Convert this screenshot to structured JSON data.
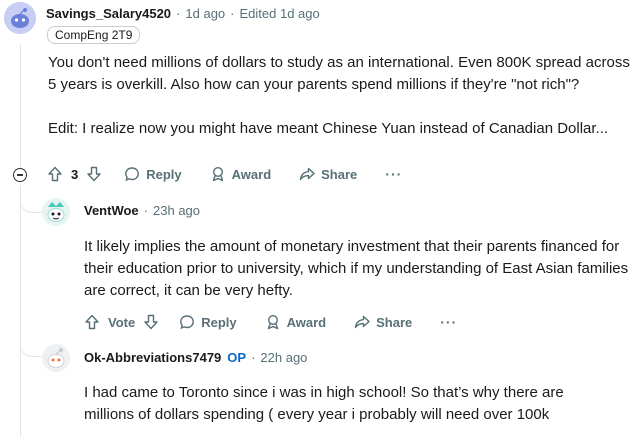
{
  "comments": [
    {
      "author": "Savings_Salary4520",
      "time": "1d ago",
      "edited": "Edited 1d ago",
      "flair": "CompEng 2T9",
      "paragraphs": [
        "You don't need millions of dollars to study as an international. Even 800K spread across 5 years is overkill. Also how can your parents spend millions if they're \"not rich\"?",
        "Edit: I realize now you might have meant Chinese Yuan instead of Canadian Dollar..."
      ],
      "vote_count": "3",
      "actions": {
        "reply": "Reply",
        "award": "Award",
        "share": "Share",
        "more": "···"
      }
    },
    {
      "author": "VentWoe",
      "time": "23h ago",
      "paragraphs": [
        "It likely implies the amount of monetary investment that their parents financed for their education prior to university, which if my understanding of East Asian families are correct, it can be very hefty."
      ],
      "vote_label": "Vote",
      "actions": {
        "reply": "Reply",
        "award": "Award",
        "share": "Share",
        "more": "···"
      }
    },
    {
      "author": "Ok-Abbreviations7479",
      "op_badge": "OP",
      "time": "22h ago",
      "paragraphs": [
        "I had came to Toronto since i was in high school! So that’s why there are millions of dollars spending ( every year i probably will need over 100k"
      ]
    }
  ],
  "icons": {
    "upvote": "upvote-arrow-icon",
    "downvote": "downvote-arrow-icon",
    "reply": "speech-bubble-icon",
    "award": "award-ribbon-icon",
    "share": "share-arrow-icon",
    "collapse": "minus-circle-icon"
  },
  "colors": {
    "op": "#0a66c7",
    "meta": "#576f76",
    "text": "#1a1a1b"
  }
}
